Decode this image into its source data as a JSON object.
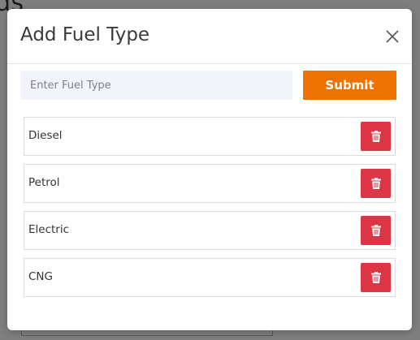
{
  "background": {
    "heading_fragment": "ds"
  },
  "modal": {
    "title": "Add Fuel Type",
    "close_icon": "close-icon"
  },
  "form": {
    "input_placeholder": "Enter Fuel Type",
    "input_value": "",
    "submit_label": "Submit"
  },
  "fuel_types": [
    {
      "name": "Diesel",
      "delete_icon": "trash-icon"
    },
    {
      "name": "Petrol",
      "delete_icon": "trash-icon"
    },
    {
      "name": "Electric",
      "delete_icon": "trash-icon"
    },
    {
      "name": "CNG",
      "delete_icon": "trash-icon"
    }
  ],
  "colors": {
    "submit": "#ef7100",
    "delete": "#dc3545",
    "input_bg": "#f1f4f8",
    "overlay": "#7f7f7f"
  }
}
